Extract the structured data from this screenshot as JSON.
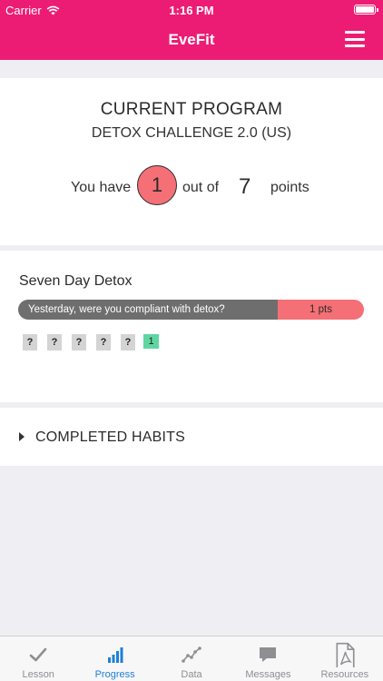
{
  "status": {
    "carrier": "Carrier",
    "time": "1:16 PM"
  },
  "header": {
    "title": "EveFit"
  },
  "program": {
    "heading": "CURRENT PROGRAM",
    "name": "DETOX CHALLENGE 2.0 (US)",
    "prefix": "You have",
    "earned": "1",
    "middle": "out of",
    "total": "7",
    "suffix": "points"
  },
  "detox": {
    "title": "Seven Day Detox",
    "question": "Yesterday, were you compliant with detox?",
    "question_points": "1 pts",
    "days": [
      "?",
      "?",
      "?",
      "?",
      "?",
      "1"
    ]
  },
  "habits": {
    "label": "COMPLETED HABITS"
  },
  "tabs": [
    {
      "label": "Lesson",
      "icon": "check-icon"
    },
    {
      "label": "Progress",
      "icon": "bar-chart-icon"
    },
    {
      "label": "Data",
      "icon": "line-chart-icon"
    },
    {
      "label": "Messages",
      "icon": "chat-bubble-icon"
    },
    {
      "label": "Resources",
      "icon": "pdf-document-icon"
    }
  ],
  "colors": {
    "brand": "#ec1c74",
    "points_accent": "#f47076",
    "tab_active": "#1f7fd6",
    "complete_day": "#5fd6a2"
  }
}
